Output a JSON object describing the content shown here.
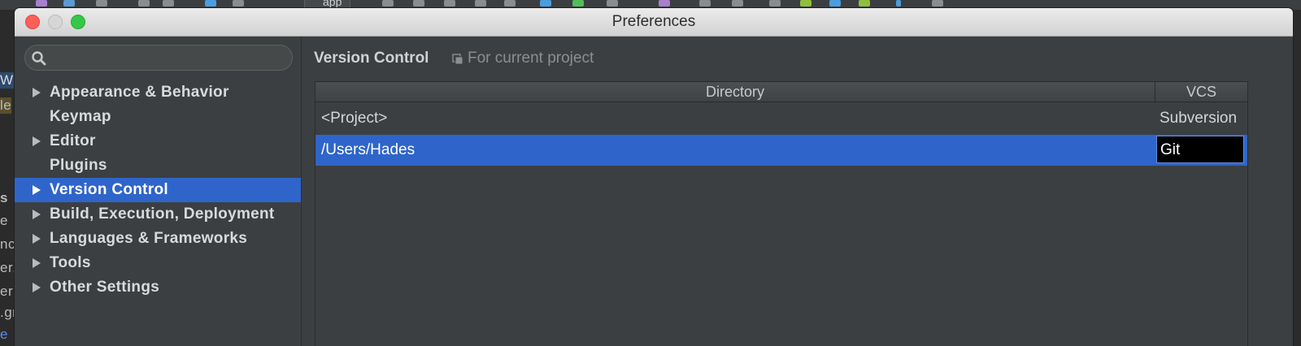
{
  "ide": {
    "toolbar_app_label": "app",
    "left_fragments": [
      "Wo",
      "le",
      "s",
      "e",
      "nc",
      "er.",
      "err",
      ".gr",
      "e"
    ]
  },
  "dialog": {
    "title": "Preferences"
  },
  "sidebar": {
    "search": {
      "value": "",
      "placeholder": ""
    },
    "items": [
      {
        "label": "Appearance & Behavior",
        "expandable": true,
        "selected": false
      },
      {
        "label": "Keymap",
        "expandable": false,
        "selected": false
      },
      {
        "label": "Editor",
        "expandable": true,
        "selected": false
      },
      {
        "label": "Plugins",
        "expandable": false,
        "selected": false
      },
      {
        "label": "Version Control",
        "expandable": true,
        "selected": true
      },
      {
        "label": "Build, Execution, Deployment",
        "expandable": true,
        "selected": false
      },
      {
        "label": "Languages & Frameworks",
        "expandable": true,
        "selected": false
      },
      {
        "label": "Tools",
        "expandable": true,
        "selected": false
      },
      {
        "label": "Other Settings",
        "expandable": true,
        "selected": false
      }
    ]
  },
  "content": {
    "title": "Version Control",
    "scope_label": "For current project",
    "table": {
      "headers": {
        "directory": "Directory",
        "vcs": "VCS"
      },
      "rows": [
        {
          "directory": "<Project>",
          "vcs": "Subversion",
          "selected": false
        },
        {
          "directory": "/Users/Hades",
          "vcs": "Git",
          "selected": true,
          "editing": true
        }
      ]
    }
  },
  "colors": {
    "selection": "#2f65ca",
    "panel": "#3c3f41",
    "text": "#d8dadb",
    "muted_text": "#8c8f91",
    "close_button": "#fc5f57",
    "zoom_button": "#34c84a"
  }
}
